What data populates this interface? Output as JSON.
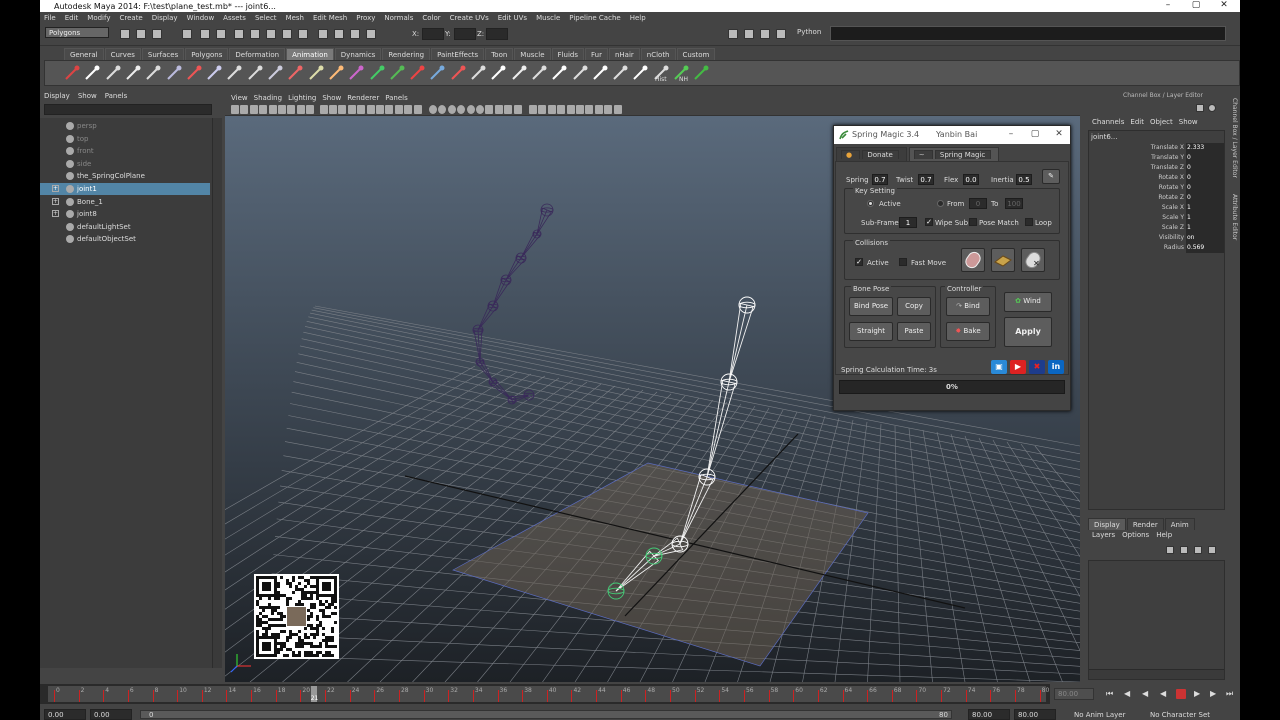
{
  "window": {
    "title": "Autodesk Maya 2014: F:\\test\\plane_test.mb*   ---   joint6...",
    "minimize": "–",
    "maximize": "▢",
    "close": "✕"
  },
  "menubar": [
    "File",
    "Edit",
    "Modify",
    "Create",
    "Display",
    "Window",
    "Assets",
    "Select",
    "Mesh",
    "Edit Mesh",
    "Proxy",
    "Normals",
    "Color",
    "Create UVs",
    "Edit UVs",
    "Muscle",
    "Pipeline Cache",
    "Help"
  ],
  "statusline": {
    "mode": "Polygons",
    "x_label": "X:",
    "y_label": "Y:",
    "z_label": "Z:",
    "python_label": "Python"
  },
  "shelf_tabs": [
    "General",
    "Curves",
    "Surfaces",
    "Polygons",
    "Deformation",
    "Animation",
    "Dynamics",
    "Rendering",
    "PaintEffects",
    "Toon",
    "Muscle",
    "Fluids",
    "Fur",
    "nHair",
    "nCloth",
    "Custom"
  ],
  "shelf_active": "Animation",
  "shelf_labels": {
    "hist": "Hist",
    "nh": "NH"
  },
  "outliner": {
    "menu": [
      "Display",
      "Show",
      "Panels"
    ],
    "items": [
      {
        "label": "persp",
        "dim": true,
        "expand": false,
        "selected": false
      },
      {
        "label": "top",
        "dim": true,
        "expand": false,
        "selected": false
      },
      {
        "label": "front",
        "dim": true,
        "expand": false,
        "selected": false
      },
      {
        "label": "side",
        "dim": true,
        "expand": false,
        "selected": false
      },
      {
        "label": "the_SpringColPlane",
        "dim": false,
        "expand": false,
        "selected": false
      },
      {
        "label": "joint1",
        "dim": false,
        "expand": true,
        "selected": true
      },
      {
        "label": "Bone_1",
        "dim": false,
        "expand": true,
        "selected": false
      },
      {
        "label": "joint8",
        "dim": false,
        "expand": true,
        "selected": false
      },
      {
        "label": "defaultLightSet",
        "dim": false,
        "expand": false,
        "selected": false
      },
      {
        "label": "defaultObjectSet",
        "dim": false,
        "expand": false,
        "selected": false
      }
    ]
  },
  "viewport": {
    "menu": [
      "View",
      "Shading",
      "Lighting",
      "Show",
      "Renderer",
      "Panels"
    ]
  },
  "spring_magic": {
    "title": "Spring Magic 3.4",
    "author": "Yanbin Bai",
    "tabs": [
      "Donate",
      "Spring Magic"
    ],
    "spring_label": "Spring",
    "spring_value": "0.7",
    "twist_label": "Twist",
    "twist_value": "0.7",
    "flex_label": "Flex",
    "flex_value": "0.0",
    "inertia_label": "Inertia",
    "inertia_value": "0.5",
    "key_setting_label": "Key Setting",
    "active_label": "Active",
    "from_label": "From",
    "from_value": "0",
    "to_label": "To",
    "to_value": "100",
    "subframe_label": "Sub-Frame",
    "subframe_value": "1",
    "wipe_sub_label": "Wipe Sub",
    "pose_match_label": "Pose Match",
    "loop_label": "Loop",
    "collisions_label": "Collisions",
    "col_active_label": "Active",
    "fast_move_label": "Fast Move",
    "bone_pose_label": "Bone Pose",
    "bind_pose_btn": "Bind Pose",
    "copy_btn": "Copy",
    "straight_btn": "Straight",
    "paste_btn": "Paste",
    "controller_label": "Controller",
    "bind_btn": "Bind",
    "bake_btn": "Bake",
    "wind_btn": "Wind",
    "apply_btn": "Apply",
    "calc_time": "Spring Calculation Time: 3s",
    "progress": "0%",
    "progress_fraction": 0,
    "social": {
      "yt": "▶",
      "in": "in",
      "uk": "✖",
      "tv": "▣"
    }
  },
  "channel_box": {
    "title": "Channel Box / Layer Editor",
    "menu": [
      "Channels",
      "Edit",
      "Object",
      "Show"
    ],
    "object": "joint6...",
    "attributes": [
      {
        "name": "Translate X",
        "value": "2.333"
      },
      {
        "name": "Translate Y",
        "value": "0"
      },
      {
        "name": "Translate Z",
        "value": "0"
      },
      {
        "name": "Rotate X",
        "value": "0"
      },
      {
        "name": "Rotate Y",
        "value": "0"
      },
      {
        "name": "Rotate Z",
        "value": "0"
      },
      {
        "name": "Scale X",
        "value": "1"
      },
      {
        "name": "Scale Y",
        "value": "1"
      },
      {
        "name": "Scale Z",
        "value": "1"
      },
      {
        "name": "Visibility",
        "value": "on"
      },
      {
        "name": "Radius",
        "value": "0.569"
      }
    ],
    "side_tabs": [
      "Channel Box / Layer Editor",
      "Attribute Editor"
    ],
    "layer_tabs": [
      "Display",
      "Render",
      "Anim"
    ],
    "layer_menu": [
      "Layers",
      "Options",
      "Help"
    ]
  },
  "timeline": {
    "ticks": [
      "0",
      "2",
      "4",
      "6",
      "8",
      "10",
      "12",
      "14",
      "16",
      "18",
      "20",
      "22",
      "24",
      "26",
      "28",
      "30",
      "32",
      "34",
      "36",
      "38",
      "40",
      "42",
      "44",
      "46",
      "48",
      "50",
      "52",
      "54",
      "56",
      "58",
      "60",
      "62",
      "64",
      "66",
      "68",
      "70",
      "72",
      "74",
      "76",
      "78",
      "80"
    ],
    "current_frame": "21",
    "current_time_field": "80.00"
  },
  "range": {
    "start": "0.00",
    "start2": "0.00",
    "slider_start": "0",
    "slider_end": "80",
    "end1": "80.00",
    "end2": "80.00",
    "anim_layer": "No Anim Layer",
    "char_set": "No Character Set"
  }
}
